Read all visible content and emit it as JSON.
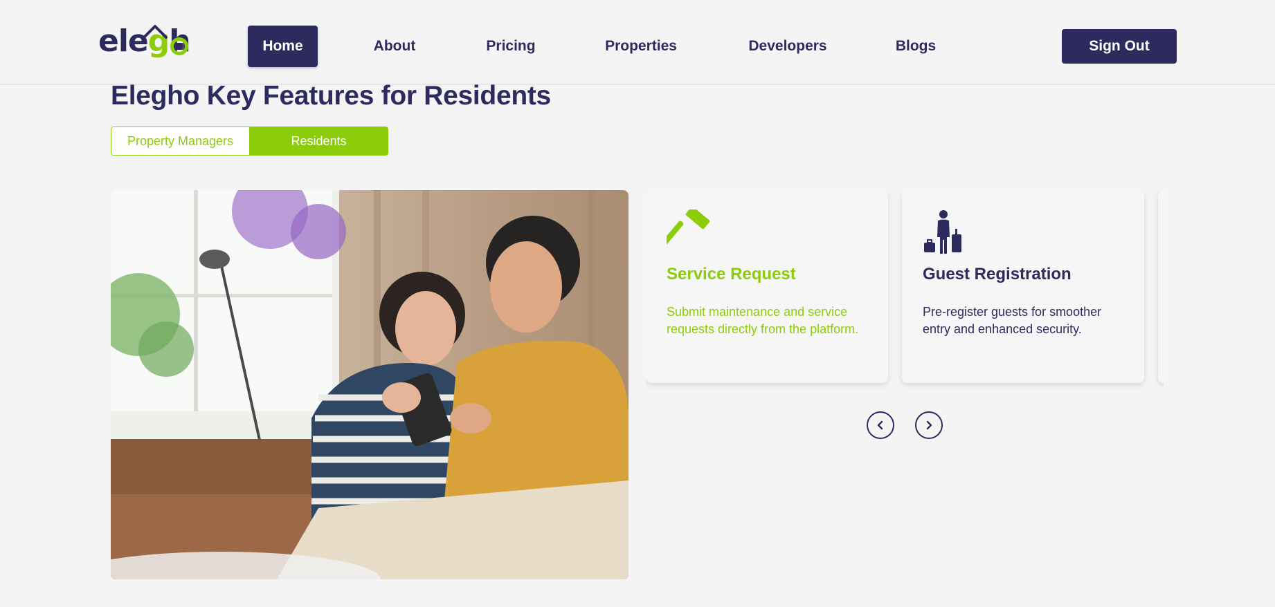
{
  "brand": {
    "logo_part1": "ele",
    "logo_part2": "g",
    "logo_part3": "h"
  },
  "nav": {
    "items": [
      {
        "label": "Home",
        "active": true
      },
      {
        "label": "About"
      },
      {
        "label": "Pricing"
      },
      {
        "label": "Properties"
      },
      {
        "label": "Developers"
      },
      {
        "label": "Blogs"
      }
    ],
    "sign_out": "Sign Out"
  },
  "section": {
    "title": "Elegho Key Features for Residents",
    "toggle": {
      "option1": "Property Managers",
      "option2": "Residents",
      "selected": "Residents"
    }
  },
  "features": [
    {
      "icon": "hammer-icon",
      "title": "Service Request",
      "description": "Submit maintenance and service requests directly from the platform.",
      "color": "#8ccc0a"
    },
    {
      "icon": "guest-luggage-icon",
      "title": "Guest Registration",
      "description": "Pre-register guests for smoother entry and enhanced security.",
      "color": "#2d2a5e"
    }
  ],
  "colors": {
    "navy": "#2d2a5e",
    "green": "#8ccc0a",
    "background": "#f4f4f4"
  }
}
